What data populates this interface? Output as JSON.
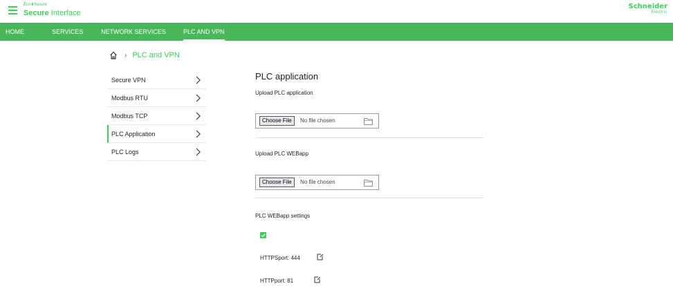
{
  "header": {
    "eco_prefix": "Eco",
    "eco_suffix": "truxure",
    "app_bold": "Secure",
    "app_rest": " Interface",
    "logo_main": "Schneider",
    "logo_sub": "Electric",
    "brand_color": "#3dcd58"
  },
  "nav": {
    "items": [
      {
        "label": "HOME"
      },
      {
        "label": "SERVICES"
      },
      {
        "label": "NETWORK SERVICES"
      },
      {
        "label": "PLC AND VPN"
      }
    ],
    "active": "PLC AND VPN",
    "bar_color": "#47b75a"
  },
  "breadcrumb": {
    "icon": "home-icon",
    "separator": "›",
    "current": "PLC and VPN"
  },
  "sidebar": {
    "items": [
      {
        "label": "Secure VPN"
      },
      {
        "label": "Modbus RTU"
      },
      {
        "label": "Modbus TCP"
      },
      {
        "label": "PLC Application"
      },
      {
        "label": "PLC Logs"
      }
    ],
    "active": "PLC Application"
  },
  "main": {
    "title": "PLC application",
    "upload_app_label": "Upload PLC application",
    "upload_webapp_label": "Upload PLC WEBapp",
    "file_button": "Choose File",
    "file_status": "No file chosen",
    "webapp_settings_label": "PLC WEBapp settings",
    "webapp_enabled": true,
    "https_port": "HTTPSport: 444",
    "http_port": "HTTPport: 81"
  }
}
